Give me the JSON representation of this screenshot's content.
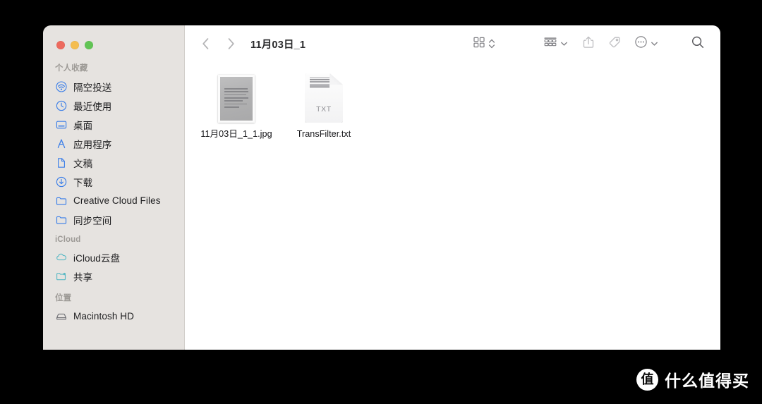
{
  "window": {
    "title": "11月03日_1",
    "traffic_lights": [
      {
        "name": "close",
        "color": "#ED6A5E"
      },
      {
        "name": "minimize",
        "color": "#F4BD4F"
      },
      {
        "name": "maximize",
        "color": "#61C454"
      }
    ]
  },
  "toolbar": {
    "back_icon": "chevron-left-icon",
    "forward_icon": "chevron-right-icon",
    "view_mode_icon": "icon-view-grid-icon",
    "view_mode_chevron_icon": "chevron-up-down-icon",
    "group_by_icon": "group-by-list-icon",
    "group_by_chevron_icon": "chevron-down-icon",
    "share_icon": "share-icon",
    "tag_icon": "tag-icon",
    "more_icon": "ellipsis-circle-icon",
    "more_chevron_icon": "chevron-down-icon",
    "search_icon": "search-icon"
  },
  "sidebar": {
    "sections": [
      {
        "header": "个人收藏",
        "items": [
          {
            "label": "隔空投送",
            "icon": "airdrop-icon"
          },
          {
            "label": "最近使用",
            "icon": "clock-icon"
          },
          {
            "label": "桌面",
            "icon": "desktop-icon"
          },
          {
            "label": "应用程序",
            "icon": "applications-icon"
          },
          {
            "label": "文稿",
            "icon": "document-icon"
          },
          {
            "label": "下载",
            "icon": "download-icon"
          },
          {
            "label": "Creative Cloud Files",
            "icon": "folder-icon"
          },
          {
            "label": "同步空间",
            "icon": "folder-icon"
          }
        ]
      },
      {
        "header": "iCloud",
        "items": [
          {
            "label": "iCloud云盘",
            "icon": "cloud-icon"
          },
          {
            "label": "共享",
            "icon": "shared-folder-icon"
          }
        ]
      },
      {
        "header": "位置",
        "items": [
          {
            "label": "Macintosh HD",
            "icon": "hard-drive-icon"
          }
        ]
      }
    ]
  },
  "files": [
    {
      "name": "11月03日_1_1.jpg",
      "kind": "image",
      "icon": "jpg-thumbnail"
    },
    {
      "name": "TransFilter.txt",
      "kind": "text",
      "icon": "txt-file-icon",
      "badge": "TXT"
    }
  ],
  "watermark": {
    "logo_text": "值",
    "text": "什么值得买"
  }
}
